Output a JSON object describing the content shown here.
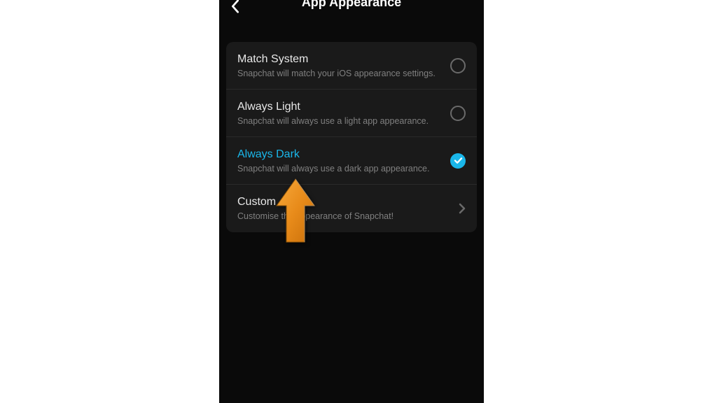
{
  "header": {
    "title": "App Appearance"
  },
  "options": [
    {
      "title": "Match System",
      "subtitle": "Snapchat will match your iOS appearance settings.",
      "selected": false,
      "type": "radio"
    },
    {
      "title": "Always Light",
      "subtitle": "Snapchat will always use a light app appearance.",
      "selected": false,
      "type": "radio"
    },
    {
      "title": "Always Dark",
      "subtitle": "Snapchat will always use a dark app appearance.",
      "selected": true,
      "type": "radio"
    },
    {
      "title": "Custom",
      "subtitle": "Customise the appearance of Snapchat!",
      "selected": false,
      "type": "nav"
    }
  ],
  "colors": {
    "accent": "#1ab7ea",
    "arrow": "#e88b1a"
  }
}
